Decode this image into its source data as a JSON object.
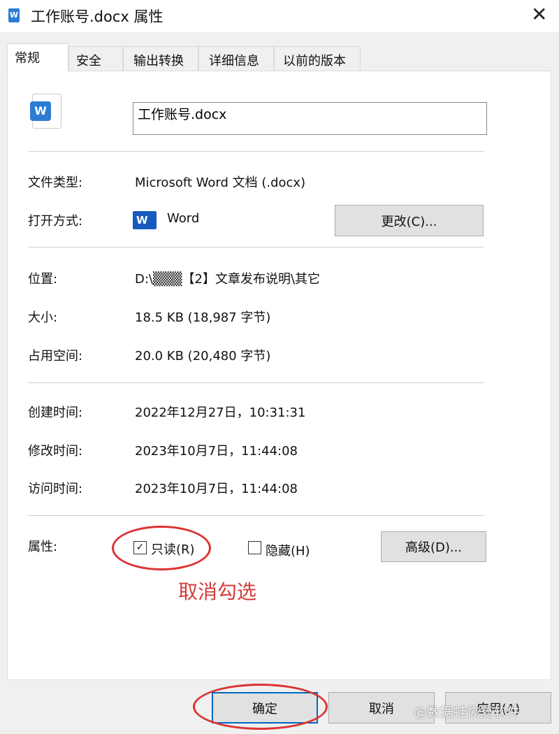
{
  "window": {
    "title": "工作账号.docx 属性",
    "close_icon": "close-icon"
  },
  "tabs": [
    {
      "label": "常规",
      "active": true
    },
    {
      "label": "安全"
    },
    {
      "label": "输出转换"
    },
    {
      "label": "详细信息"
    },
    {
      "label": "以前的版本"
    }
  ],
  "general": {
    "filename": "工作账号.docx",
    "file_type_label": "文件类型:",
    "file_type": "Microsoft Word 文档 (.docx)",
    "opens_with_label": "打开方式:",
    "opens_with": "Word",
    "change_button": "更改(C)...",
    "location_label": "位置:",
    "location": "D:\\▒▒▒【2】文章发布说明\\其它",
    "size_label": "大小:",
    "size": "18.5 KB (18,987 字节)",
    "size_on_disk_label": "占用空间:",
    "size_on_disk": "20.0 KB (20,480 字节)",
    "created_label": "创建时间:",
    "created": "2022年12月27日，10:31:31",
    "modified_label": "修改时间:",
    "modified": "2023年10月7日，11:44:08",
    "accessed_label": "访问时间:",
    "accessed": "2023年10月7日，11:44:08",
    "attributes_label": "属性:",
    "readonly": {
      "label": "只读(R)",
      "checked": true
    },
    "hidden": {
      "label": "隐藏(H)",
      "checked": false
    },
    "advanced_button": "高级(D)..."
  },
  "annotation": {
    "text": "取消勾选",
    "color": "#d33b3b"
  },
  "footer": {
    "ok": "确定",
    "cancel": "取消",
    "apply": "应用(A)"
  },
  "watermark": "@数据蛙恢复软件"
}
